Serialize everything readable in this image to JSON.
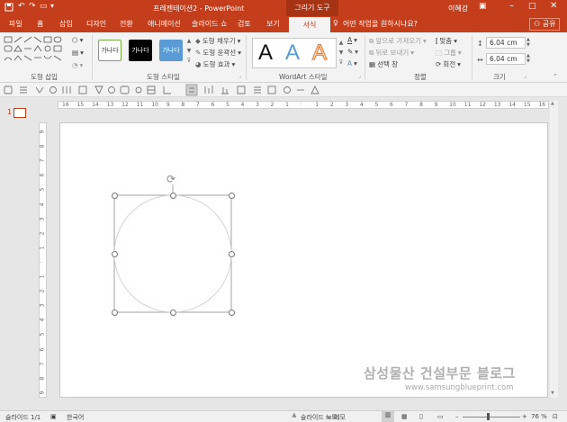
{
  "window": {
    "title": "프레젠테이션2 - PowerPoint",
    "context_tab": "그리기 도구",
    "user": "이혜강",
    "share_label": "공유",
    "tell_me": "어떤 작업을 원하시나요?"
  },
  "tabs": [
    {
      "label": "파일"
    },
    {
      "label": "홈"
    },
    {
      "label": "삽입"
    },
    {
      "label": "디자인"
    },
    {
      "label": "전환"
    },
    {
      "label": "애니메이션"
    },
    {
      "label": "슬라이드 쇼"
    },
    {
      "label": "검토"
    },
    {
      "label": "보기"
    },
    {
      "label": "서식"
    }
  ],
  "ribbon": {
    "groups": {
      "insert_shapes": "도형 삽입",
      "shape_styles": "도형 스타일",
      "wordart_styles": "WordArt 스타일",
      "arrange": "정렬",
      "size": "크기"
    },
    "style_samples": [
      "가나다",
      "가나다",
      "가나다"
    ],
    "shape_fill": "도형 채우기",
    "shape_outline": "도형 윤곽선",
    "shape_effects": "도형 효과",
    "wordart_samples": [
      "A",
      "A",
      "A"
    ],
    "bring_forward": "앞으로 가져오기",
    "send_backward": "뒤로 보내기",
    "selection_pane": "선택 창",
    "align": "맞춤",
    "group": "그룹",
    "rotate": "회전",
    "height": "6.04 cm",
    "width": "6.04 cm"
  },
  "slides_pane": {
    "slide_number": "1"
  },
  "ruler": {
    "h_labels": [
      "16",
      "15",
      "14",
      "13",
      "12",
      "11",
      "10",
      "9",
      "8",
      "7",
      "6",
      "5",
      "4",
      "3",
      "2",
      "1",
      "",
      "1",
      "2",
      "3",
      "4",
      "5",
      "6",
      "7",
      "8",
      "9",
      "10",
      "11",
      "12",
      "13",
      "14",
      "15",
      "16"
    ],
    "v_labels": [
      "9",
      "8",
      "7",
      "6",
      "5",
      "4",
      "3",
      "2",
      "1",
      "",
      "1",
      "2",
      "3",
      "4",
      "5",
      "6",
      "7",
      "8",
      "9"
    ]
  },
  "watermark": {
    "title": "삼성물산 건설부문 블로그",
    "url": "www.samsungblueprint.com"
  },
  "status": {
    "slide_info": "슬라이드 1/1",
    "language": "한국어",
    "notes": "슬라이드 노트",
    "comments": "메모",
    "zoom": "76 %"
  },
  "colors": {
    "accent": "#c43e1c",
    "wordart_blue": "#5b9bd5",
    "wordart_orange": "#ed7d31"
  }
}
